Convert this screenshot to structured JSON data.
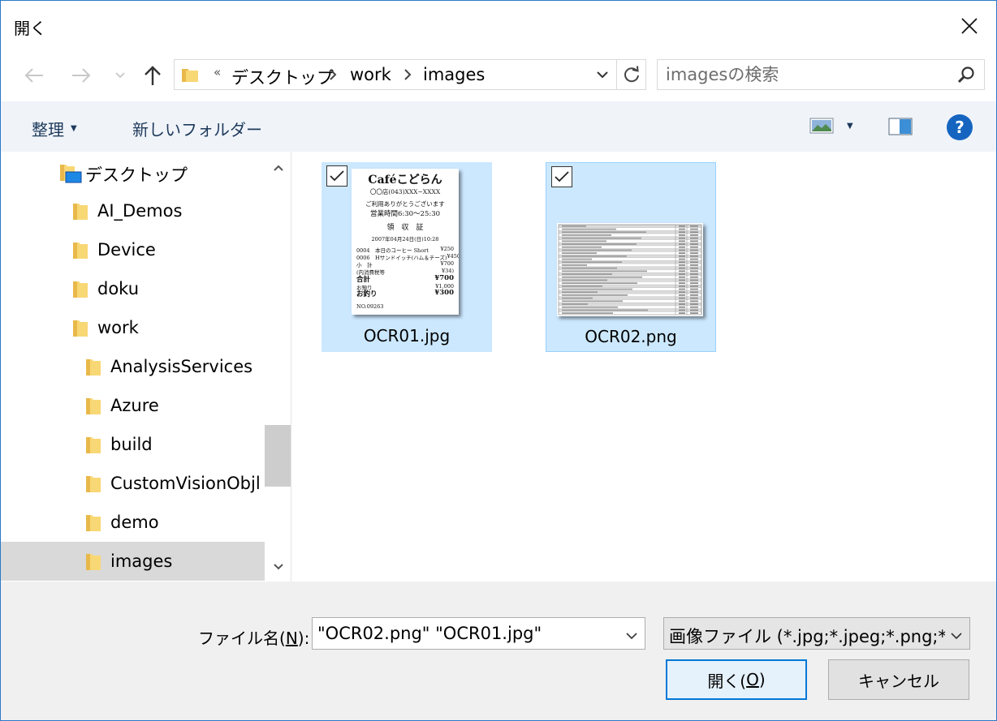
{
  "window": {
    "title": "開く"
  },
  "address": {
    "overflow": "«",
    "crumbs": [
      "デスクトップ",
      "work",
      "images"
    ]
  },
  "search": {
    "placeholder": "imagesの検索"
  },
  "toolbar": {
    "organize": "整理",
    "new_folder": "新しいフォルダー",
    "help": "?"
  },
  "nav": {
    "items": [
      {
        "label": "デスクトップ",
        "type": "desktop",
        "level": 1
      },
      {
        "label": "AI_Demos",
        "type": "folder",
        "level": 2
      },
      {
        "label": "Device",
        "type": "folder",
        "level": 2
      },
      {
        "label": "doku",
        "type": "folder",
        "level": 2
      },
      {
        "label": "work",
        "type": "folder",
        "level": 2
      },
      {
        "label": "AnalysisServices",
        "type": "folder",
        "level": 3
      },
      {
        "label": "Azure",
        "type": "folder",
        "level": 3
      },
      {
        "label": "build",
        "type": "folder",
        "level": 3
      },
      {
        "label": "CustomVisionObjl",
        "type": "folder",
        "level": 3
      },
      {
        "label": "demo",
        "type": "folder",
        "level": 3
      },
      {
        "label": "images",
        "type": "folder",
        "level": 3,
        "selected": true
      }
    ]
  },
  "files": [
    {
      "name": "OCR01.jpg",
      "checked": true,
      "receipt": {
        "shop": "Caféこどらん",
        "branch": "〇〇店(043)XXX−XXXX",
        "thanks": "ご利用ありがとうございます",
        "hours": "営業時間6:30〜25:30",
        "heading": "領　収　証",
        "date": "2007年04月24日(日)10:28",
        "lines": [
          {
            "label": "0004　本日のコーヒー Short",
            "value": "¥250"
          },
          {
            "label": "0006　Hサンドイッチ(ハム＆チーズ)",
            "value": "¥450"
          },
          {
            "label": "小　計",
            "value": "¥700"
          },
          {
            "label": "(内消費税等",
            "value": "¥34)"
          }
        ],
        "totals": [
          {
            "label": "合計",
            "value": "¥700"
          },
          {
            "label": "お預り",
            "value": "¥1,000"
          },
          {
            "label": "お釣り",
            "value": "¥300"
          }
        ],
        "number": "NO.09263"
      }
    },
    {
      "name": "OCR02.png",
      "checked": true
    }
  ],
  "bottom": {
    "filename_label_prefix": "ファイル名(",
    "filename_label_key": "N",
    "filename_label_suffix": "):",
    "filename_value": "\"OCR02.png\" \"OCR01.jpg\"",
    "filetype_value": "画像ファイル (*.jpg;*.jpeg;*.png;*.gif)",
    "open_prefix": "開く(",
    "open_key": "O",
    "open_suffix": ")",
    "cancel": "キャンセル"
  },
  "colors": {
    "accent": "#0078d7",
    "selection": "#cce8ff",
    "toolbar_bg": "#f0f4f9",
    "folder": "#f8d775"
  }
}
